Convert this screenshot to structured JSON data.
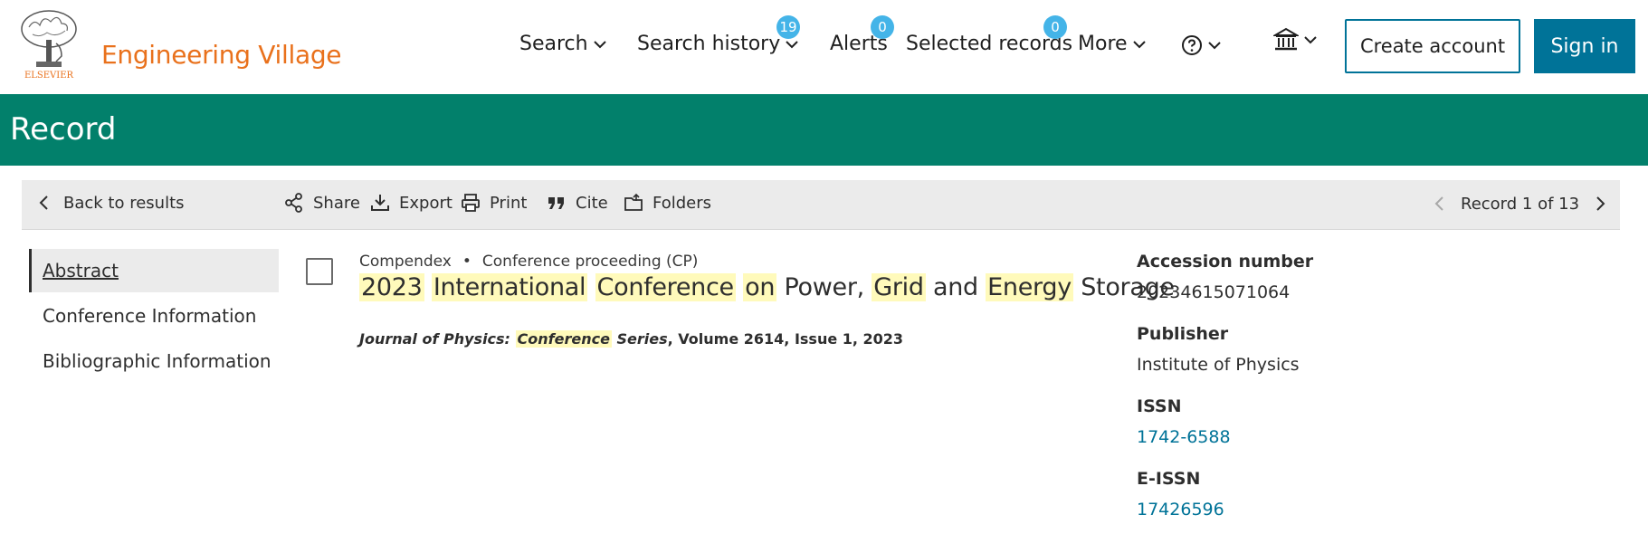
{
  "header": {
    "logo_text": "ELSEVIER",
    "brand": "Engineering Village",
    "nav": {
      "search": "Search",
      "search_history": "Search history",
      "search_history_count": "19",
      "alerts": "Alerts",
      "alerts_count": "0",
      "selected_records": "Selected records",
      "selected_records_count": "0",
      "more": "More"
    },
    "create_account": "Create account",
    "sign_in": "Sign in"
  },
  "banner": {
    "title": "Record"
  },
  "toolbar": {
    "back": "Back to results",
    "share": "Share",
    "export": "Export",
    "print": "Print",
    "cite": "Cite",
    "folders": "Folders",
    "record_position": "Record 1 of 13"
  },
  "leftnav": {
    "items": [
      "Abstract",
      "Conference Information",
      "Bibliographic Information"
    ]
  },
  "record": {
    "database": "Compendex",
    "doc_type": "Conference proceeding (CP)",
    "title_parts": [
      "2023",
      "International",
      "Conference",
      "on",
      "Power,",
      "Grid",
      "and",
      "Energy",
      "Storage"
    ],
    "title_highlighted": [
      true,
      true,
      true,
      true,
      false,
      true,
      false,
      true,
      false
    ],
    "source_journal": "Journal of Physics:",
    "source_highlight": "Conference",
    "source_series": "Series",
    "source_rest": ", Volume 2614, Issue 1, 2023"
  },
  "details": {
    "accession_label": "Accession number",
    "accession_value": "20234615071064",
    "publisher_label": "Publisher",
    "publisher_value": "Institute of Physics",
    "issn_label": "ISSN",
    "issn_value": "1742-6588",
    "eissn_label": "E-ISSN",
    "eissn_value": "17426596"
  },
  "colors": {
    "brand_orange": "#e9711c",
    "banner_green": "#02806b",
    "link_blue": "#007398",
    "badge_blue": "#44b4e8",
    "highlight": "#fffabb"
  }
}
